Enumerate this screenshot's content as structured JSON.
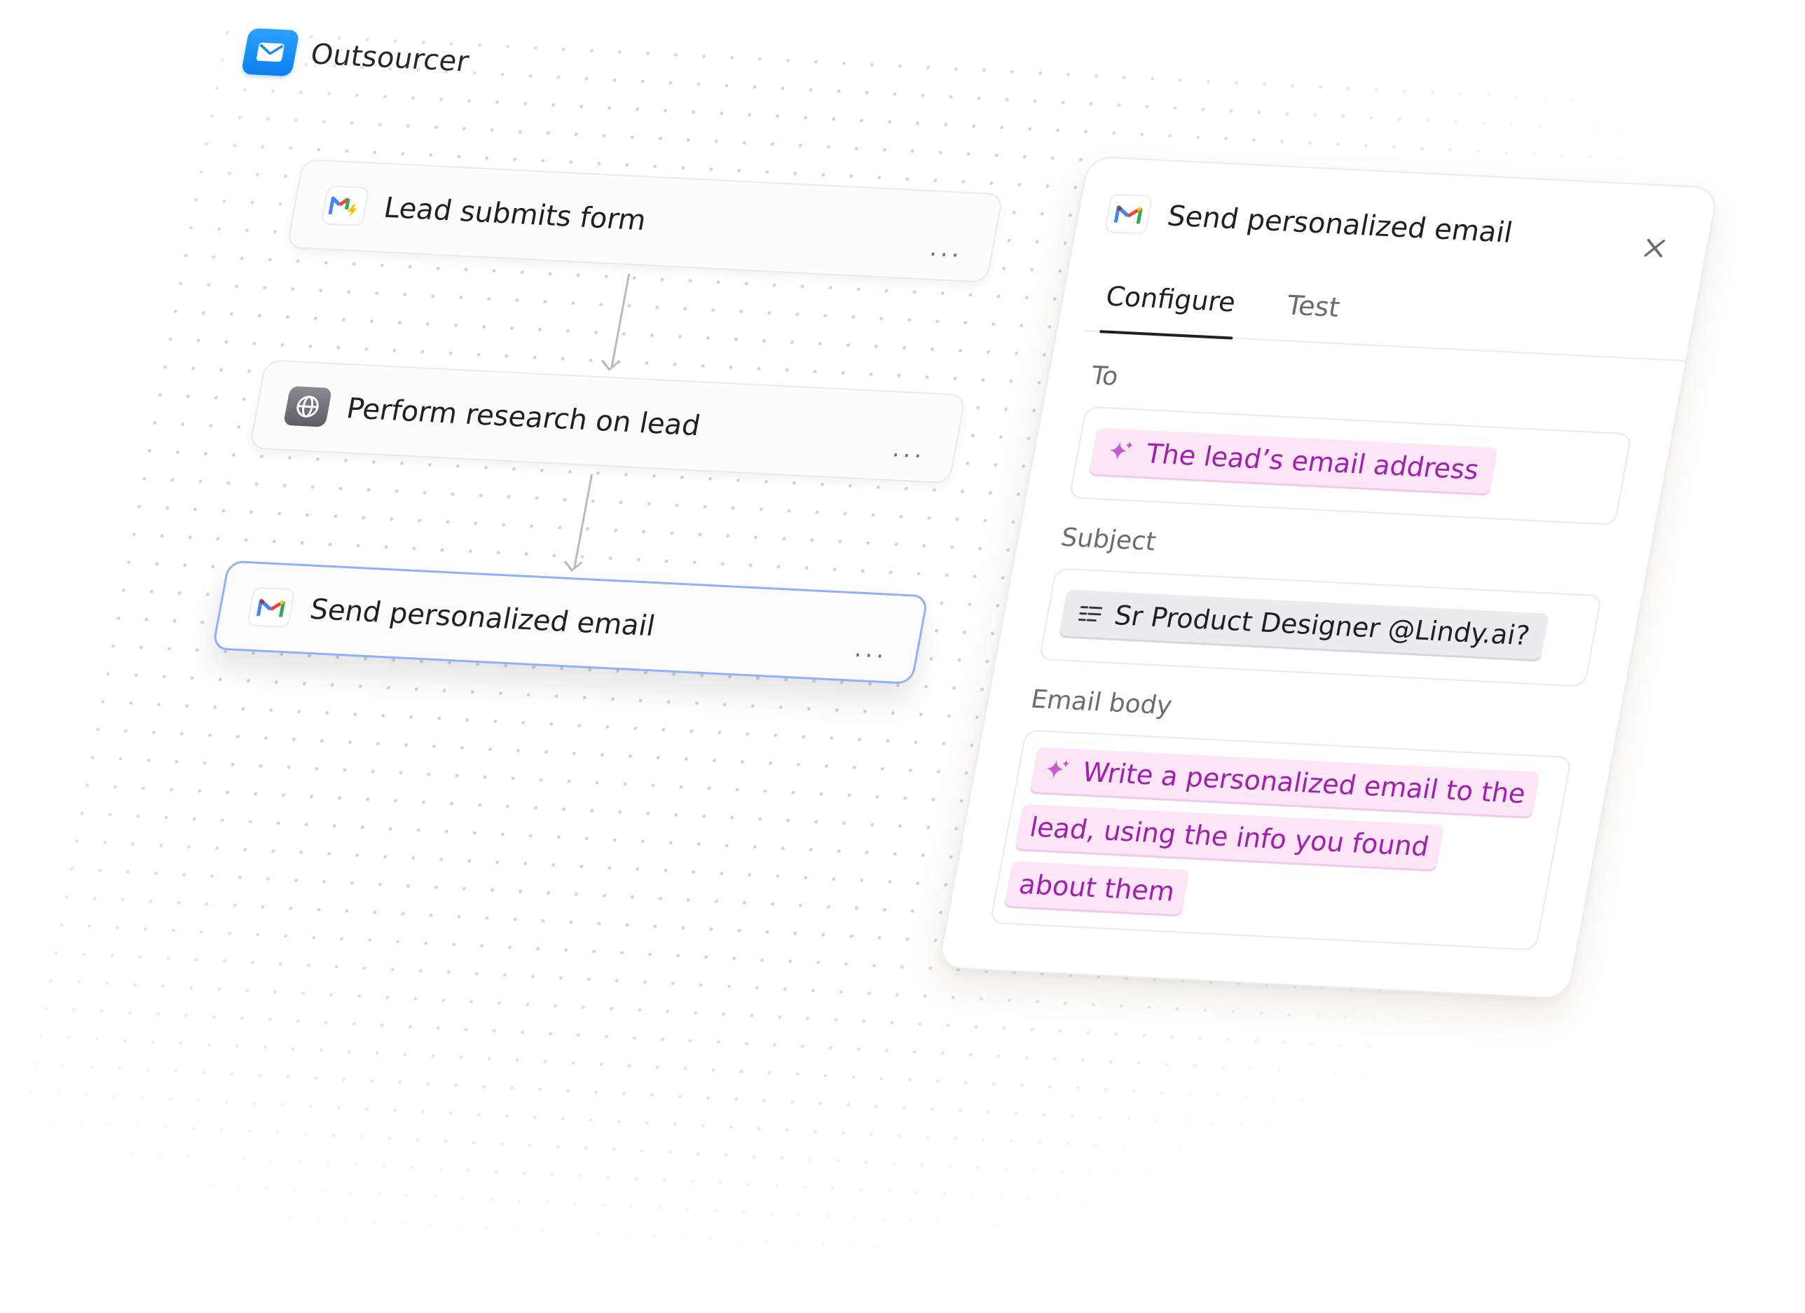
{
  "app": {
    "title": "Outsourcer"
  },
  "workflow": {
    "nodes": [
      {
        "label": "Lead submits form",
        "icon": "gmail-trigger-icon",
        "more": "..."
      },
      {
        "label": "Perform research on lead",
        "icon": "globe-icon",
        "more": "..."
      },
      {
        "label": "Send personalized email",
        "icon": "gmail-icon",
        "more": "...",
        "selected": true
      }
    ]
  },
  "panel": {
    "title": "Send personalized email",
    "tabs": [
      "Configure",
      "Test"
    ],
    "active_tab": "Configure",
    "to": {
      "label": "To",
      "chip": "The lead’s email address",
      "chip_icon": "sparkle-icon"
    },
    "subject": {
      "label": "Subject",
      "chip": "Sr Product Designer @Lindy.ai?",
      "chip_icon": "variable-lines-icon"
    },
    "email_body": {
      "label": "Email body",
      "lines": [
        "Write a personalized email to the",
        "lead, using the info you found",
        "about them"
      ],
      "chip_icon": "sparkle-icon"
    }
  },
  "colors": {
    "accent_blue": "#8fb0ff",
    "ai_text": "#a11faf",
    "ai_bg": "#fbe5f6",
    "app_icon": "#1a91f5"
  }
}
